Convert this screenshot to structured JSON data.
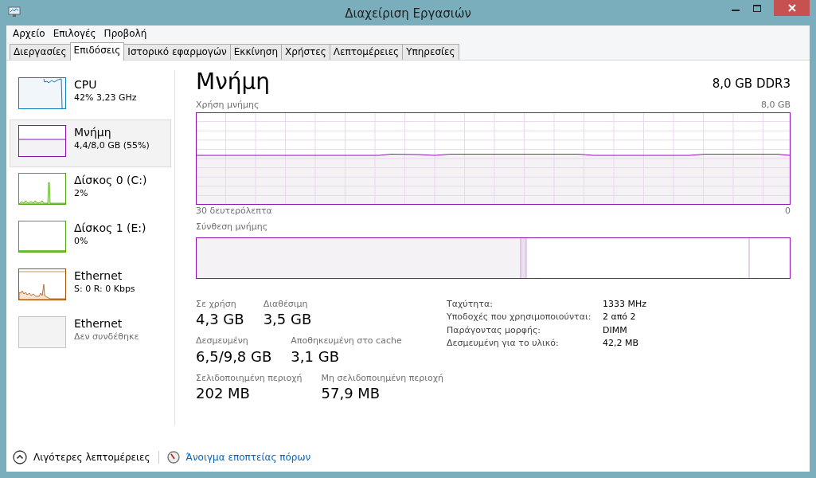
{
  "window": {
    "title": "Διαχείριση Εργασιών"
  },
  "menu": [
    "Αρχείο",
    "Επιλογές",
    "Προβολή"
  ],
  "tabs": [
    {
      "label": "Διεργασίες",
      "selected": false
    },
    {
      "label": "Επιδόσεις",
      "selected": true
    },
    {
      "label": "Ιστορικό εφαρμογών",
      "selected": false
    },
    {
      "label": "Εκκίνηση",
      "selected": false
    },
    {
      "label": "Χρήστες",
      "selected": false
    },
    {
      "label": "Λεπτομέρειες",
      "selected": false
    },
    {
      "label": "Υπηρεσίες",
      "selected": false
    }
  ],
  "sidebar": {
    "items": [
      {
        "kind": "cpu",
        "title": "CPU",
        "subtitle": "42%  3,23 GHz",
        "selected": false
      },
      {
        "kind": "memory",
        "title": "Μνήμη",
        "subtitle": "4,4/8,0 GB (55%)",
        "selected": true
      },
      {
        "kind": "disk",
        "title": "Δίσκος 0 (C:)",
        "subtitle": "2%",
        "selected": false
      },
      {
        "kind": "disk-idle",
        "title": "Δίσκος 1 (E:)",
        "subtitle": "0%",
        "selected": false
      },
      {
        "kind": "network",
        "title": "Ethernet",
        "subtitle": "S: 0 R: 0 Kbps",
        "selected": false
      },
      {
        "kind": "disconnected",
        "title": "Ethernet",
        "subtitle": "Δεν συνδέθηκε",
        "selected": false
      }
    ]
  },
  "main": {
    "title": "Μνήμη",
    "hardware": "8,0 GB DDR3",
    "usage_graph": {
      "label": "Χρήση μνήμης",
      "max_label": "8,0 GB",
      "time_label": "30 δευτερόλεπτα",
      "zero_label": "0"
    },
    "composition": {
      "label": "Σύνθεση μνήμης"
    },
    "stat_rows": [
      [
        {
          "label": "Σε χρήση",
          "value": "4,3 GB"
        },
        {
          "label": "Διαθέσιμη",
          "value": "3,5 GB"
        }
      ],
      [
        {
          "label": "Δεσμευμένη",
          "value": "6,5/9,8 GB"
        },
        {
          "label": "Αποθηκευμένη στο cache",
          "value": "3,1 GB"
        }
      ],
      [
        {
          "label": "Σελιδοποιημένη περιοχή",
          "value": "202 MB"
        },
        {
          "label": "Μη σελιδοποιημένη περιοχή",
          "value": "57,9 MB"
        }
      ]
    ],
    "details": [
      {
        "label": "Ταχύτητα:",
        "value": "1333 MHz"
      },
      {
        "label": "Υποδοχές που χρησιμοποιούνται:",
        "value": "2 από 2"
      },
      {
        "label": "Παράγοντας μορφής:",
        "value": "DIMM"
      },
      {
        "label": "Δεσμευμένη για το υλικό:",
        "value": "42,2 MB"
      }
    ]
  },
  "footer": {
    "less_details": "Λιγότερες λεπτομέρειες",
    "resource_monitor": "Άνοιγμα εποπτείας πόρων"
  }
}
